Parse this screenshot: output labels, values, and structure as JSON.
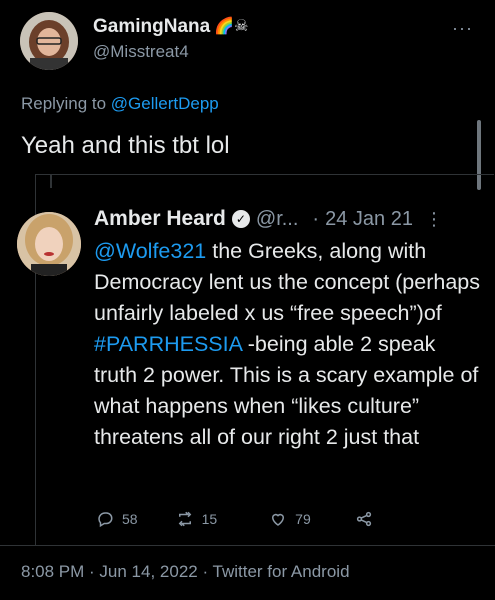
{
  "reply_tweet": {
    "display_name": "GamingNana",
    "name_emojis": "🌈☠",
    "handle": "@Misstreat4",
    "more": "···",
    "replying_prefix": "Replying to",
    "replying_to": "@GellertDepp",
    "text": "Yeah and this tbt lol",
    "timestamp": "8:08 PM · Jun 14, 2022 · Twitter for Android"
  },
  "quoted_tweet": {
    "display_name": "Amber Heard",
    "handle": "@r...",
    "dot": "·",
    "date": "24 Jan 21",
    "more": "⋮",
    "mention": "@Wolfe321",
    "text_part1": " the Greeks, along with Democracy lent us the concept (perhaps unfairly labeled x us “free speech”)of ",
    "hashtag": "#PARRHESSIA",
    "text_part2": " -being able 2 speak truth 2 power. This is a scary example of what happens when “likes culture” threatens all of our right 2 just that",
    "reply_count": "58",
    "retweet_count": "15",
    "like_count": "79"
  },
  "colors": {
    "background": "#000000",
    "text": "#e7e9ea",
    "muted": "#8b98a5",
    "link": "#1d9bf0"
  }
}
